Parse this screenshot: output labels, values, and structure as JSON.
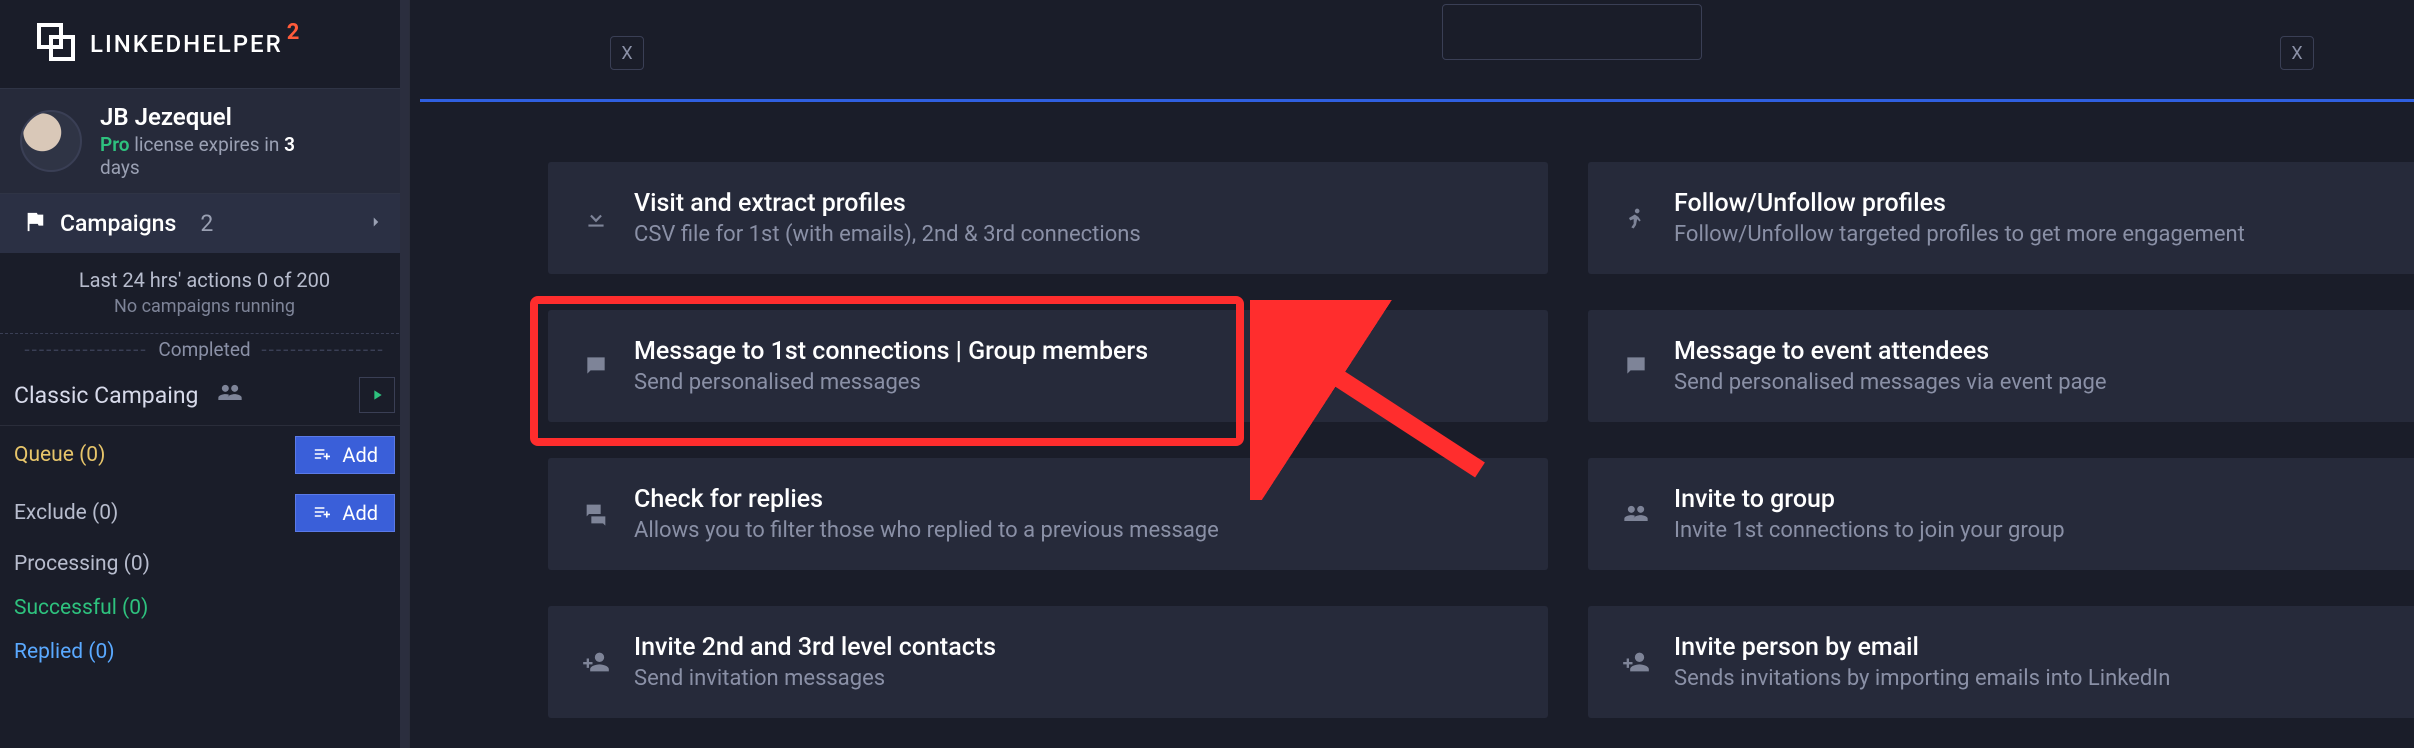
{
  "brand": {
    "word": "LINKEDHELPER",
    "sup": "2"
  },
  "profile": {
    "name": "JB Jezequel",
    "pro_tag": "Pro",
    "license_mid": " license expires in ",
    "days_num": "3",
    "days_word": "days"
  },
  "nav": {
    "campaigns": {
      "label": "Campaigns",
      "count": "2"
    }
  },
  "stats": {
    "line": "Last 24 hrs' actions 0 of 200",
    "sub": "No campaigns running"
  },
  "completed_label": "Completed",
  "campaign": {
    "title": "Classic Campaing"
  },
  "filters": {
    "queue": "Queue (0)",
    "exclude": "Exclude (0)",
    "processing": "Processing (0)",
    "successful": "Successful (0)",
    "replied": "Replied (0)",
    "add_label": "Add"
  },
  "close_x": "X",
  "cards": {
    "visit": {
      "title": "Visit and extract profiles",
      "sub": "CSV file for 1st (with emails), 2nd & 3rd connections"
    },
    "follow": {
      "title": "Follow/Unfollow profiles",
      "sub": "Follow/Unfollow targeted profiles to get more engagement"
    },
    "msg1st": {
      "title": "Message to 1st connections | Group members",
      "sub": "Send personalised messages"
    },
    "msgEvt": {
      "title": "Message to event attendees",
      "sub": "Send personalised messages via event page"
    },
    "check": {
      "title": "Check for replies",
      "sub": "Allows you to filter those who replied to a previous message"
    },
    "invGrp": {
      "title": "Invite to group",
      "sub": "Invite 1st connections to join your group"
    },
    "inv23": {
      "title": "Invite 2nd and 3rd level contacts",
      "sub": "Send invitation messages"
    },
    "invEmail": {
      "title": "Invite person by email",
      "sub": "Sends invitations by importing emails into LinkedIn"
    }
  }
}
